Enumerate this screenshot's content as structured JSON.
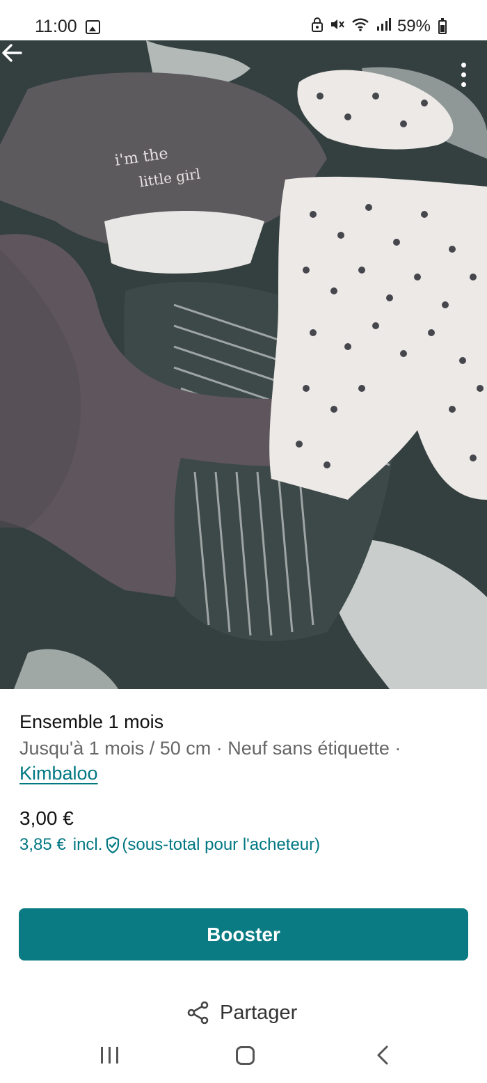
{
  "status_bar": {
    "time": "11:00",
    "battery": "59%",
    "icons": [
      "gallery-icon",
      "lock-icon",
      "mute-icon",
      "wifi-icon",
      "signal-icon",
      "battery-icon"
    ]
  },
  "photo": {
    "icons": [
      "back-arrow-icon",
      "more-vert-icon"
    ]
  },
  "item": {
    "title": "Ensemble 1 mois",
    "details": "Jusqu'à 1 mois / 50 cm · Neuf sans étiquette ·",
    "brand": "Kimbaloo",
    "price": "3,00 €",
    "buyer_price": "3,85 €",
    "buyer_incl": "incl.",
    "buyer_note": "(sous-total pour l'acheteur)"
  },
  "actions": {
    "booster_label": "Booster",
    "share_label": "Partager"
  },
  "colors": {
    "accent": "#007782",
    "button": "#0a7b82"
  }
}
